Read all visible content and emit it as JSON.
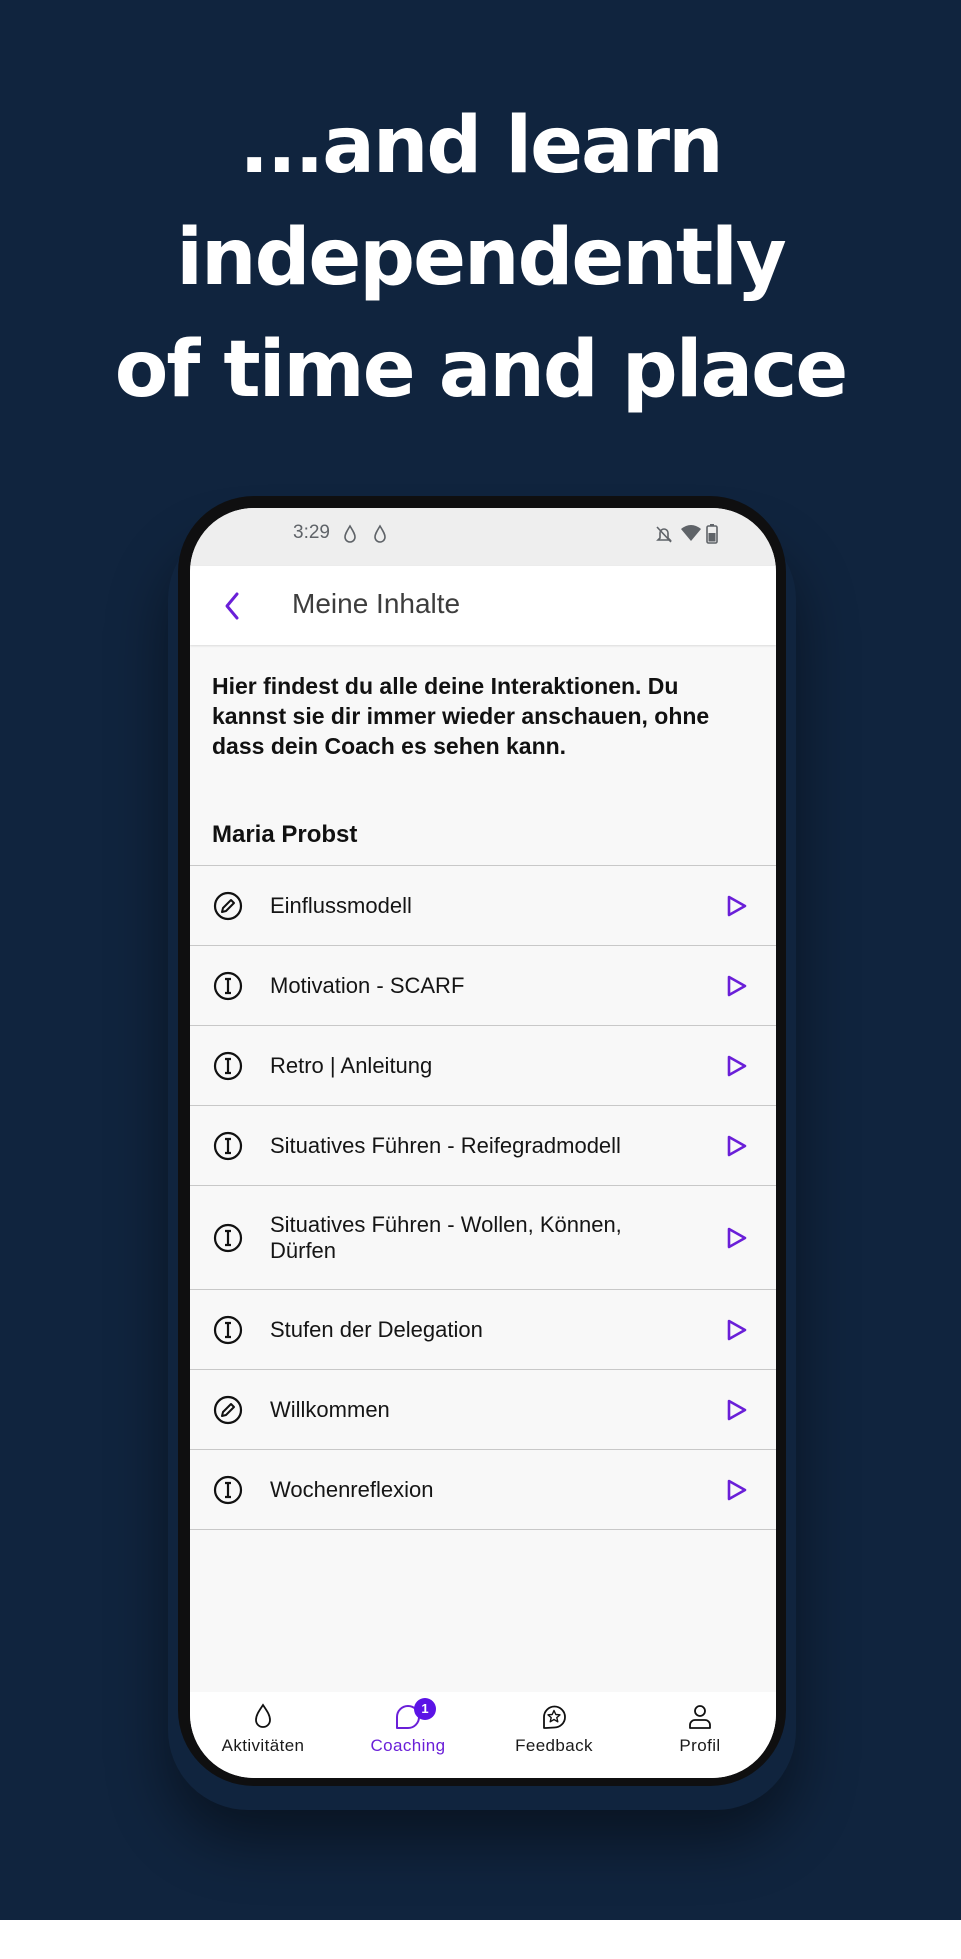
{
  "headline": {
    "lines": [
      "...and learn",
      "independently",
      "of time and place"
    ]
  },
  "colors": {
    "background": "#10243e",
    "accent": "#6a1fd8",
    "badge": "#5b13e6"
  },
  "statusbar": {
    "time": "3:29",
    "left_icons": [
      "drop-icon",
      "drop-icon"
    ],
    "right_icons": [
      "notifications-off-icon",
      "wifi-icon",
      "battery-icon"
    ]
  },
  "appbar": {
    "back_icon": "chevron-left-icon",
    "title": "Meine Inhalte"
  },
  "intro_text": "Hier findest du alle deine Interaktionen. Du kannst sie dir immer wieder anschauen, ohne dass dein Coach es sehen kann.",
  "section_title": "Maria Probst",
  "items": [
    {
      "label": "Einflussmodell",
      "icon": "pencil-circle-icon"
    },
    {
      "label": "Motivation - SCARF",
      "icon": "info-circle-icon"
    },
    {
      "label": "Retro | Anleitung",
      "icon": "info-circle-icon"
    },
    {
      "label": "Situatives Führen - Reifegradmodell",
      "icon": "info-circle-icon"
    },
    {
      "label": "Situatives Führen - Wollen, Können, Dürfen",
      "icon": "info-circle-icon"
    },
    {
      "label": "Stufen der Delegation",
      "icon": "info-circle-icon"
    },
    {
      "label": "Willkommen",
      "icon": "pencil-circle-icon"
    },
    {
      "label": "Wochenreflexion",
      "icon": "info-circle-icon"
    }
  ],
  "bottom_nav": [
    {
      "label": "Aktivitäten",
      "icon": "drop-icon",
      "active": false
    },
    {
      "label": "Coaching",
      "icon": "chat-bubble-icon",
      "active": true,
      "badge": "1"
    },
    {
      "label": "Feedback",
      "icon": "star-bubble-icon",
      "active": false
    },
    {
      "label": "Profil",
      "icon": "person-icon",
      "active": false
    }
  ]
}
